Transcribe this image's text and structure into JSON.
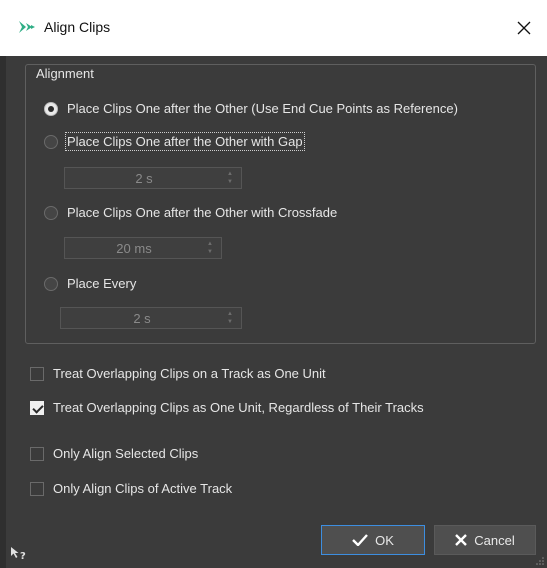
{
  "window": {
    "title": "Align Clips"
  },
  "alignment": {
    "legend": "Alignment",
    "options": [
      {
        "label": "Place Clips One after the Other (Use End Cue Points as Reference)",
        "checked": true
      },
      {
        "label": "Place Clips One after the Other with Gap",
        "checked": false,
        "spin_value": "2 s"
      },
      {
        "label": "Place Clips One after the Other with Crossfade",
        "checked": false,
        "spin_value": "20 ms"
      },
      {
        "label": "Place Every",
        "checked": false,
        "spin_value": "2 s"
      }
    ]
  },
  "checkboxes": [
    {
      "label": "Treat Overlapping Clips on a Track as One Unit",
      "checked": false
    },
    {
      "label": "Treat Overlapping Clips as One Unit, Regardless of Their Tracks",
      "checked": true
    },
    {
      "label": "Only Align Selected Clips",
      "checked": false
    },
    {
      "label": "Only Align Clips of Active Track",
      "checked": false
    }
  ],
  "buttons": {
    "ok": "OK",
    "cancel": "Cancel"
  },
  "colors": {
    "background": "#3b3b3b",
    "focus_border": "#3d8ee0",
    "app_icon": "#2fae86"
  }
}
